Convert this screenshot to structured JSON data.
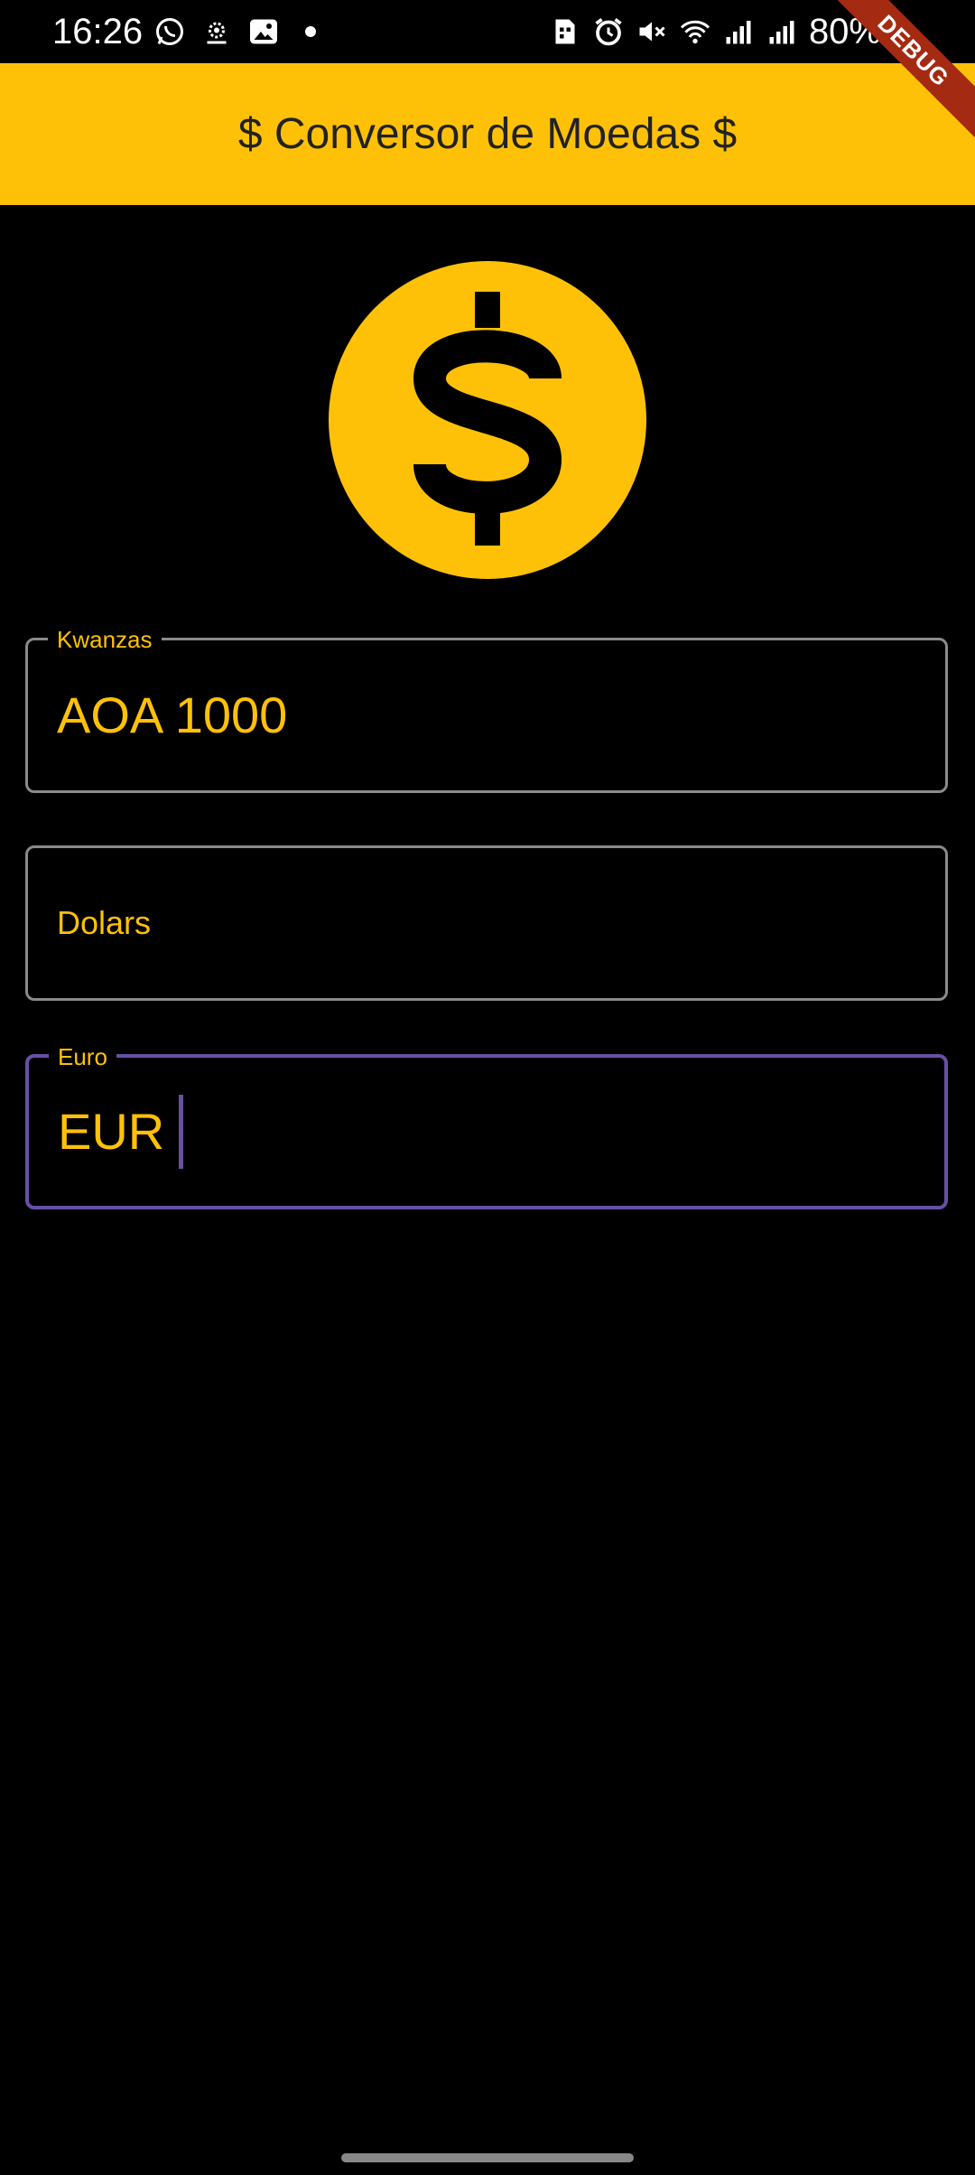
{
  "status_bar": {
    "time": "16:26",
    "left_icons": [
      "whatsapp-icon",
      "settings-gear-icon",
      "gallery-icon",
      "dot-icon"
    ],
    "right_icons": [
      "sim-icon",
      "alarm-icon",
      "mute-icon",
      "wifi-icon",
      "signal-icon",
      "signal-icon"
    ],
    "battery": "80%"
  },
  "app_bar": {
    "title": "$ Conversor de Moedas $",
    "background": "#FFC107"
  },
  "debug_banner": "DEBUG",
  "logo": {
    "icon": "dollar-coin-icon",
    "color": "#FFC107"
  },
  "fields": {
    "kwanzas": {
      "label": "Kwanzas",
      "value": "AOA 1000"
    },
    "dolars": {
      "placeholder": "Dolars"
    },
    "euro": {
      "label": "Euro",
      "value": "EUR"
    }
  },
  "colors": {
    "accent": "#FFC107",
    "focus": "#6750A4",
    "background": "#000000"
  }
}
